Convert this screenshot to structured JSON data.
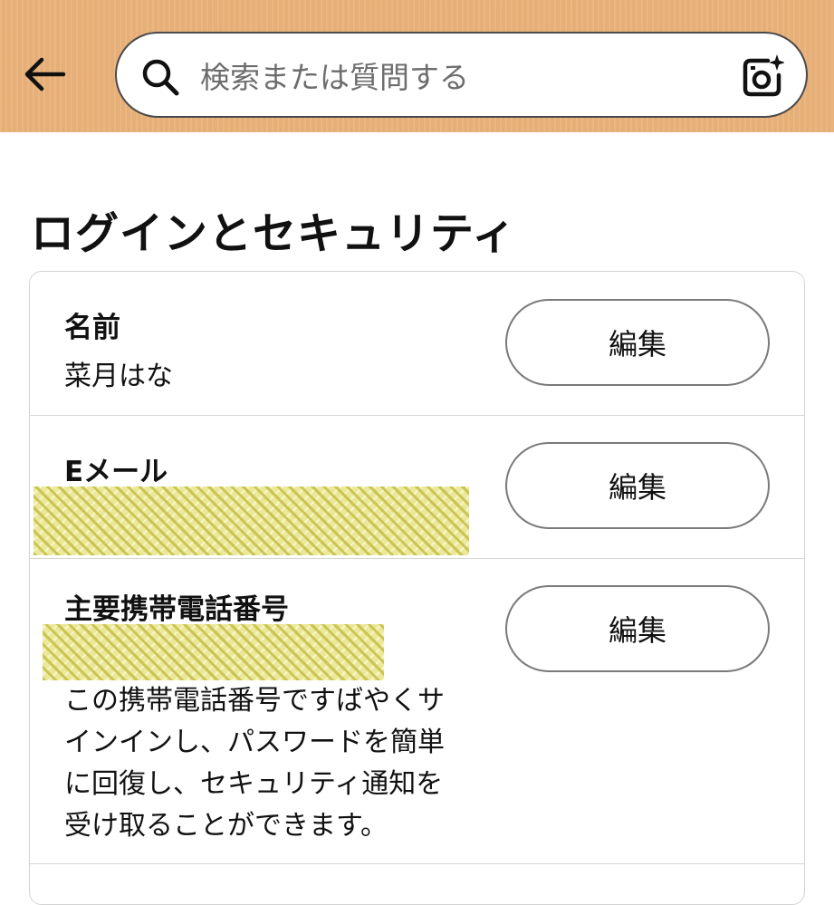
{
  "search": {
    "placeholder": "検索または質問する"
  },
  "page": {
    "title": "ログインとセキュリティ"
  },
  "rows": [
    {
      "label": "名前",
      "value": "菜月はな",
      "button": "編集"
    },
    {
      "label": "Eメール",
      "value": "",
      "value_redacted": true,
      "button": "編集"
    },
    {
      "label": "主要携帯電話番号",
      "value": "",
      "value_redacted": true,
      "description_lines": [
        "この携帯電話番号ですばやくサ",
        "インインし、パスワードを簡単",
        "に回復し、セキュリティ通知を",
        "受け取ることができます。"
      ],
      "button": "編集"
    }
  ],
  "colors": {
    "header_bg": "#eab27a",
    "redaction": "#ece89a"
  },
  "icons": {
    "back": "arrow-left",
    "search": "magnifier",
    "camera": "camera-sparkle"
  }
}
